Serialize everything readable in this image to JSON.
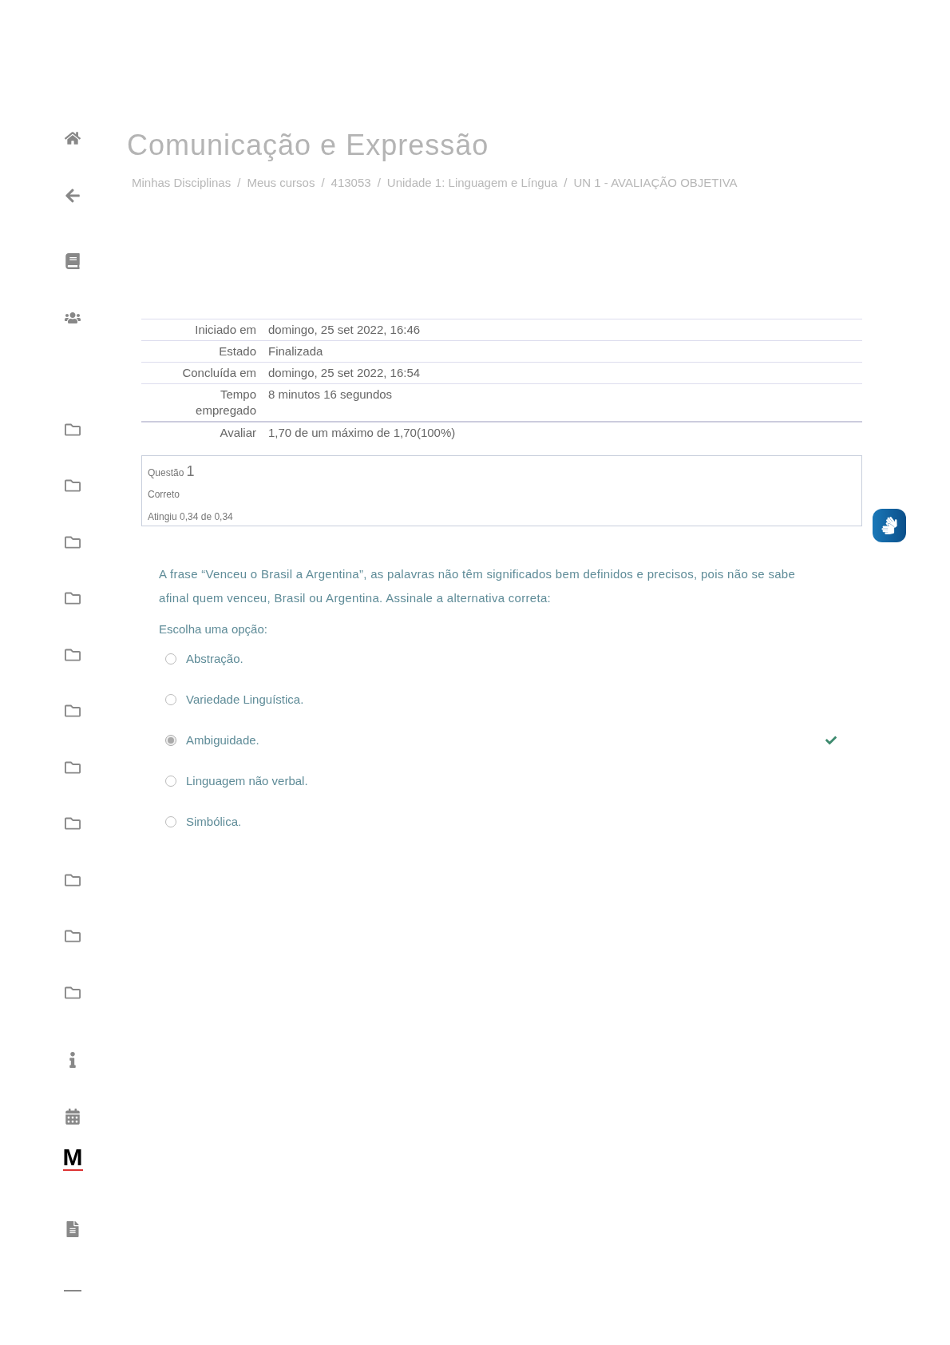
{
  "sidebar": {
    "items": [
      {
        "kind": "home"
      },
      {
        "kind": "back"
      },
      {
        "kind": "book"
      },
      {
        "kind": "users"
      },
      {
        "kind": "folder"
      },
      {
        "kind": "folder"
      },
      {
        "kind": "folder"
      },
      {
        "kind": "folder"
      },
      {
        "kind": "folder"
      },
      {
        "kind": "folder"
      },
      {
        "kind": "folder"
      },
      {
        "kind": "folder"
      },
      {
        "kind": "folder"
      },
      {
        "kind": "folder"
      },
      {
        "kind": "folder"
      },
      {
        "kind": "info"
      },
      {
        "kind": "calendar"
      },
      {
        "kind": "logo",
        "text": "M"
      },
      {
        "kind": "document"
      },
      {
        "kind": "minus"
      }
    ]
  },
  "title": "Comunicação e Expressão",
  "breadcrumb": [
    {
      "label": "Minhas Disciplinas",
      "separator": "/"
    },
    {
      "label": "Meus cursos",
      "separator": "/"
    },
    {
      "label": "413053",
      "separator": "/"
    },
    {
      "label": "Unidade 1: Linguagem e Língua",
      "separator": "/"
    },
    {
      "label": "UN 1 - AVALIAÇÃO OBJETIVA"
    }
  ],
  "summary": [
    {
      "label": "Iniciado em",
      "value": "domingo, 25 set 2022, 16:46"
    },
    {
      "label": "Estado",
      "value": "Finalizada"
    },
    {
      "label": "Concluída em",
      "value": "domingo, 25 set 2022, 16:54"
    },
    {
      "label": "Tempo empregado",
      "value": "8 minutos 16 segundos"
    },
    {
      "label": "Avaliar",
      "value": "1,70 de um máximo de 1,70(100%)"
    }
  ],
  "question_info": {
    "label": "Questão",
    "number": "1",
    "state": "Correto",
    "grade": "Atingiu 0,34 de 0,34"
  },
  "question": {
    "text": "A frase “Venceu o Brasil a Argentina”, as palavras não têm significados bem definidos e precisos, pois não se sabe afinal quem venceu, Brasil ou Argentina. Assinale a alternativa correta:",
    "prompt": "Escolha uma opção:",
    "options": [
      {
        "label": "Abstração.",
        "selected": false,
        "correct": false
      },
      {
        "label": "Variedade Linguística.",
        "selected": false,
        "correct": false
      },
      {
        "label": "Ambiguidade.",
        "selected": true,
        "correct": true
      },
      {
        "label": "Linguagem não verbal.",
        "selected": false,
        "correct": false
      },
      {
        "label": "Simbólica.",
        "selected": false,
        "correct": false
      }
    ]
  }
}
